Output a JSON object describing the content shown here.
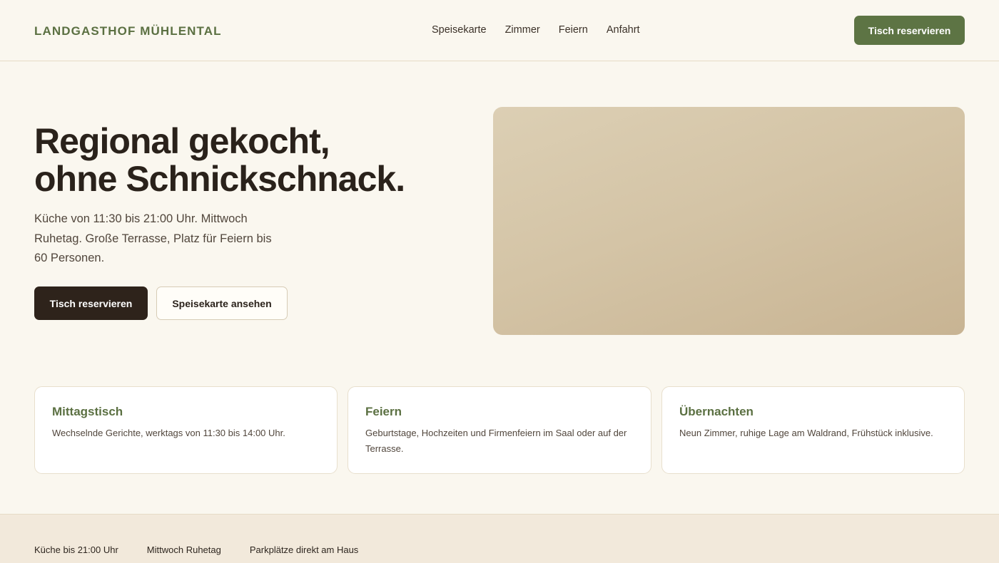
{
  "header": {
    "brand": "LANDGASTHOF MÜHLENTAL",
    "nav": [
      "Speisekarte",
      "Zimmer",
      "Feiern",
      "Anfahrt"
    ],
    "cta": "Tisch reservieren"
  },
  "hero": {
    "title_line1": "Regional gekocht,",
    "title_line2": "ohne Schnickschnack.",
    "text": "Küche von 11:30 bis 21:00 Uhr. Mittwoch Ruhetag. Große Terrasse, Platz für Feiern bis 60 Personen.",
    "primary_button": "Tisch reservieren",
    "secondary_button": "Speisekarte ansehen"
  },
  "cards": [
    {
      "title": "Mittagstisch",
      "text": "Wechselnde Gerichte, werktags von 11:30 bis 14:00 Uhr."
    },
    {
      "title": "Feiern",
      "text": "Geburtstage, Hochzeiten und Firmenfeiern im Saal oder auf der Terrasse."
    },
    {
      "title": "Übernachten",
      "text": "Neun Zimmer, ruhige Lage am Waldrand, Frühstück inklusive."
    }
  ],
  "footer": {
    "items": [
      "Küche bis 21:00 Uhr",
      "Mittwoch Ruhetag",
      "Parkplätze direkt am Haus"
    ]
  },
  "colors": {
    "background": "#faf7ef",
    "accent_green": "#5d7444",
    "dark_button": "#2e231b",
    "footer_bg": "#f2e9db"
  }
}
